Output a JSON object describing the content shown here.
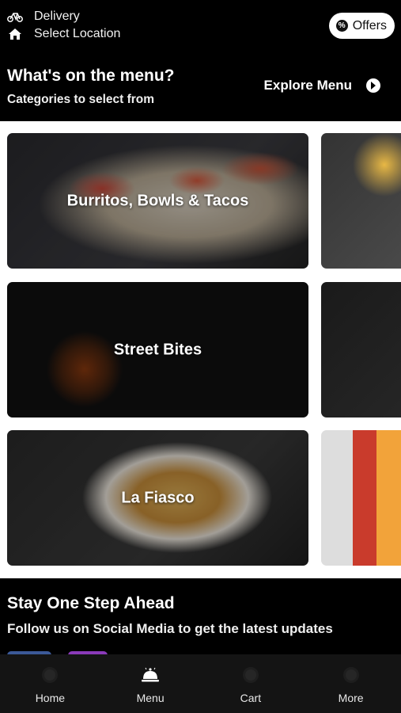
{
  "header": {
    "delivery_label": "Delivery",
    "location_label": "Select Location",
    "offers_label": "Offers",
    "menu_title": "What's on the menu?",
    "menu_subtitle": "Categories to select from",
    "explore_label": "Explore Menu"
  },
  "categories": [
    {
      "label": "Burritos, Bowls & Tacos"
    },
    {
      "label": "Street Bites"
    },
    {
      "label": "La Fiasco"
    }
  ],
  "social": {
    "title": "Stay One Step Ahead",
    "subtitle": "Follow us on Social Media to get the latest updates",
    "icons": [
      "facebook-icon",
      "instagram-icon"
    ],
    "colors": {
      "facebook": "#3b5998",
      "instagram": "#8a3ab9"
    }
  },
  "nav": {
    "items": [
      {
        "label": "Home",
        "icon": "home-icon"
      },
      {
        "label": "Menu",
        "icon": "cloche-icon"
      },
      {
        "label": "Cart",
        "icon": "cart-icon"
      },
      {
        "label": "More",
        "icon": "more-icon"
      }
    ]
  }
}
